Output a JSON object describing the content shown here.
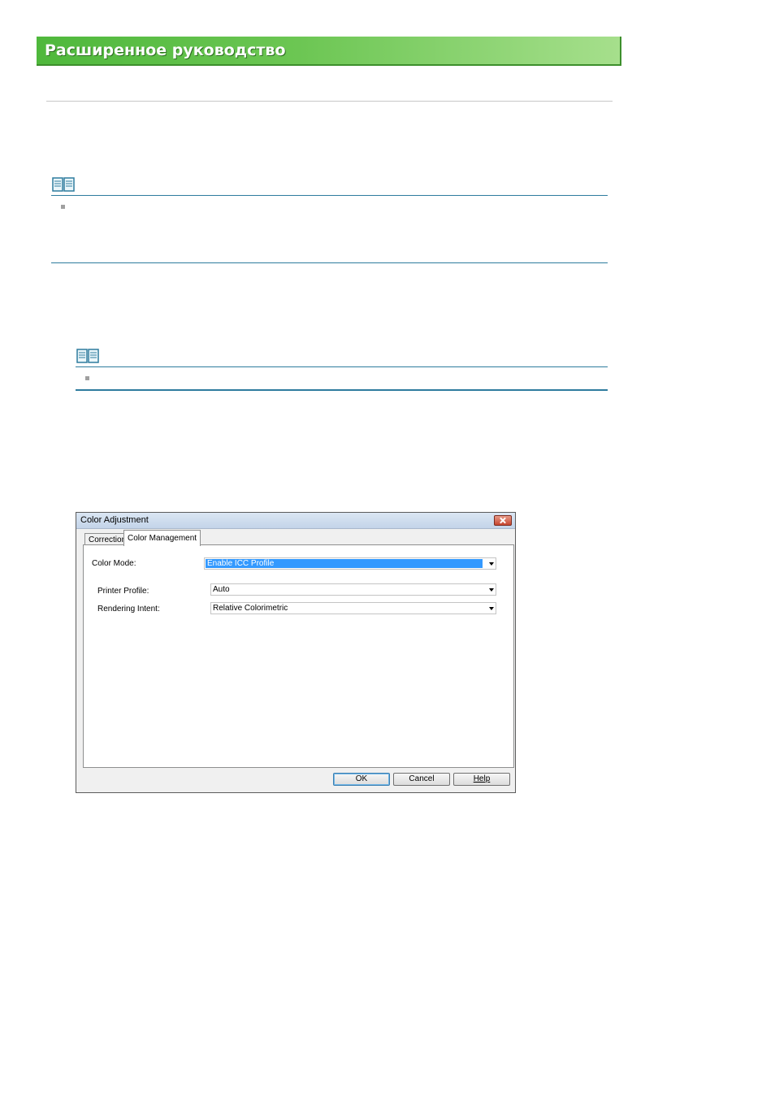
{
  "header": {
    "title": "Расширенное руководство"
  },
  "dialog": {
    "title": "Color Adjustment",
    "tabs": [
      {
        "label": "Correction",
        "active": false
      },
      {
        "label": "Color Management",
        "active": true
      }
    ],
    "color_mode": {
      "label": "Color Mode:",
      "value": "Enable ICC Profile"
    },
    "printer_profile": {
      "label": "Printer Profile:",
      "value": "Auto"
    },
    "rendering_intent": {
      "label": "Rendering Intent:",
      "value": "Relative Colorimetric"
    },
    "buttons": {
      "ok": "OK",
      "cancel": "Cancel",
      "help": "Help"
    }
  },
  "colors": {
    "banner": "#5cbf45",
    "accent_line": "#2e7c9e",
    "selection": "#3399ff"
  }
}
